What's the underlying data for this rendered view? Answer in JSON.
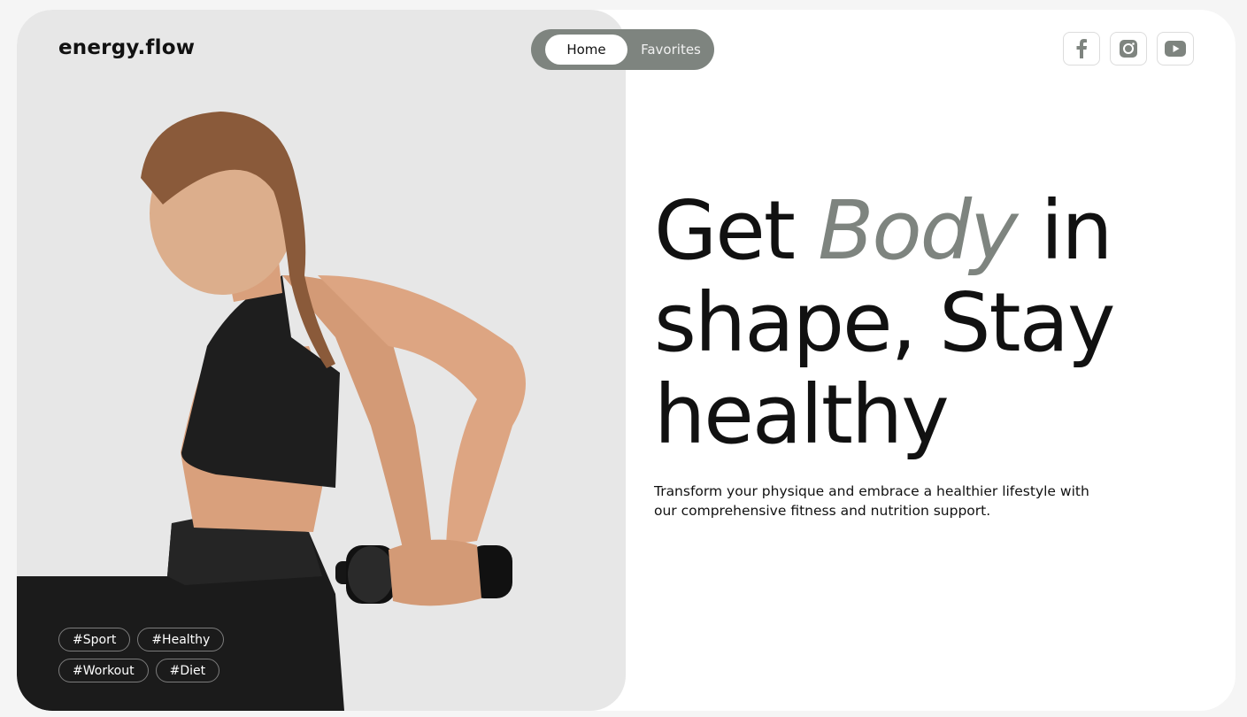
{
  "brand": {
    "logo_text": "energy.flow"
  },
  "nav": {
    "items": [
      {
        "label": "Home",
        "active": true
      },
      {
        "label": "Favorites",
        "active": false
      }
    ]
  },
  "socials": [
    {
      "name": "facebook",
      "icon": "facebook-icon"
    },
    {
      "name": "instagram",
      "icon": "instagram-icon"
    },
    {
      "name": "youtube",
      "icon": "youtube-icon"
    }
  ],
  "hero": {
    "headline_part1": "Get ",
    "headline_accent": "Body",
    "headline_part2": " in shape, Stay healthy",
    "subtitle": "Transform your physique and embrace a healthier lifestyle with our comprehensive fitness and nutrition support."
  },
  "tags": [
    "#Sport",
    "#Healthy",
    "#Workout",
    "#Diet"
  ],
  "colors": {
    "accent": "#7e847f",
    "text": "#111111",
    "hero_bg": "#e7e7e7",
    "page_bg": "#f5f5f5"
  }
}
